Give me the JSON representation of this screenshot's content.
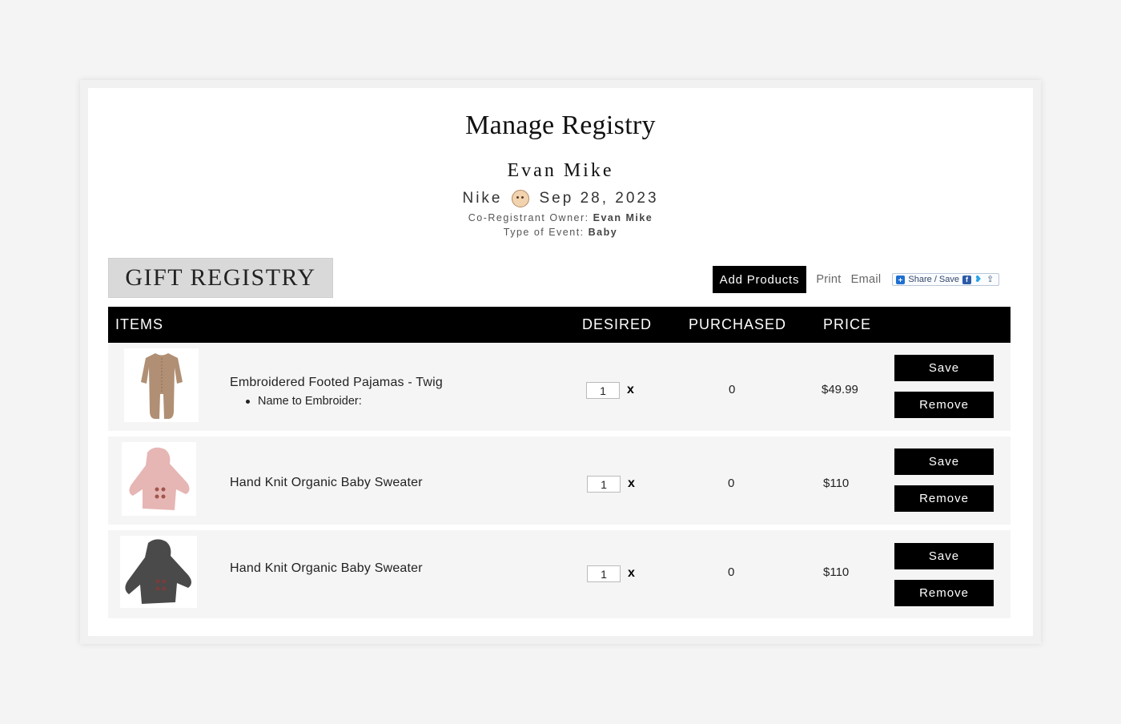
{
  "header": {
    "title": "Manage Registry",
    "registrant": "Evan Mike",
    "event_name": "Nike",
    "event_date": "Sep 28, 2023",
    "co_registrant_label": "Co-Registrant Owner:",
    "co_registrant_value": "Evan Mike",
    "event_type_label": "Type of Event:",
    "event_type_value": "Baby",
    "event_icon": "baby-face-icon"
  },
  "tab": {
    "label": "GIFT REGISTRY"
  },
  "toolbar": {
    "add_products": "Add Products",
    "print": "Print",
    "email": "Email",
    "share": "Share / Save",
    "share_icons": [
      "plus-icon",
      "facebook-icon",
      "twitter-icon",
      "share-arrow-icon"
    ]
  },
  "table": {
    "columns": [
      "ITEMS",
      "DESIRED",
      "PURCHASED",
      "PRICE"
    ],
    "rows": [
      {
        "name": "Embroidered Footed Pajamas - Twig",
        "option": "Name to Embroider:",
        "desired": "1",
        "multiplier": "x",
        "purchased": "0",
        "price": "$49.99",
        "save": "Save",
        "remove": "Remove",
        "image_color": "#b08f74"
      },
      {
        "name": "Hand Knit Organic Baby Sweater",
        "desired": "1",
        "multiplier": "x",
        "purchased": "0",
        "price": "$110",
        "save": "Save",
        "remove": "Remove",
        "image_color": "#e6b6b4"
      },
      {
        "name": "Hand Knit Organic Baby Sweater",
        "desired": "1",
        "multiplier": "x",
        "purchased": "0",
        "price": "$110",
        "save": "Save",
        "remove": "Remove",
        "image_color": "#4a4a4a"
      }
    ]
  },
  "colors": {
    "background": "#f4f4f4",
    "header_bar": "#000000",
    "tab_bg": "#d9d9d9",
    "row_bg": "#f5f5f5"
  }
}
